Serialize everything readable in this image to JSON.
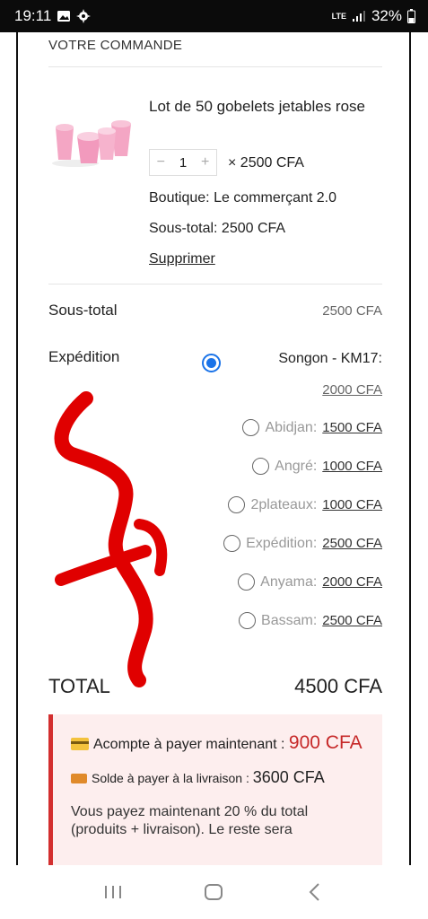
{
  "status_bar": {
    "time": "19:11",
    "network": "LTE",
    "battery": "32%"
  },
  "order": {
    "section_title": "VOTRE COMMANDE",
    "product": {
      "name": "Lot de 50 gobelets jetables rose",
      "quantity": "1",
      "minus": "−",
      "plus": "+",
      "unit_price": "× 2500 CFA",
      "shop_label": "Boutique:",
      "shop_name": "Le commerçant 2.0",
      "subtotal_text": "Sous-total: 2500 CFA",
      "delete_label": "Supprimer"
    },
    "subtotal_label": "Sous-total",
    "subtotal_value": "2500 CFA",
    "shipping_label": "Expédition",
    "shipping_selected": {
      "name": "Songon - KM17:",
      "price": "2000 CFA"
    },
    "shipping_options": [
      {
        "name": "Abidjan:",
        "price": "1500 CFA"
      },
      {
        "name": "Angré:",
        "price": "1000 CFA"
      },
      {
        "name": "2plateaux:",
        "price": "1000 CFA"
      },
      {
        "name": "Expédition:",
        "price": "2500 CFA"
      },
      {
        "name": "Anyama:",
        "price": "2000 CFA"
      },
      {
        "name": "Bassam:",
        "price": "2500 CFA"
      }
    ],
    "total_label": "TOTAL",
    "total_value": "4500 CFA"
  },
  "notice": {
    "deposit_label": "Acompte à payer maintenant :",
    "deposit_value": "900 CFA",
    "balance_label": "Solde à payer à la livraison :",
    "balance_value": "3600 CFA",
    "info_text": "Vous payez maintenant 20 % du total (produits + livraison). Le reste sera"
  },
  "colors": {
    "accent_blue": "#1a73e8",
    "notice_border": "#d32f2f",
    "notice_bg": "#fdeeee",
    "scribble": "#e00000"
  },
  "icons": [
    "gallery-icon",
    "settings-icon",
    "signal-icon",
    "battery-icon",
    "recent-apps-icon",
    "home-icon",
    "back-icon"
  ]
}
